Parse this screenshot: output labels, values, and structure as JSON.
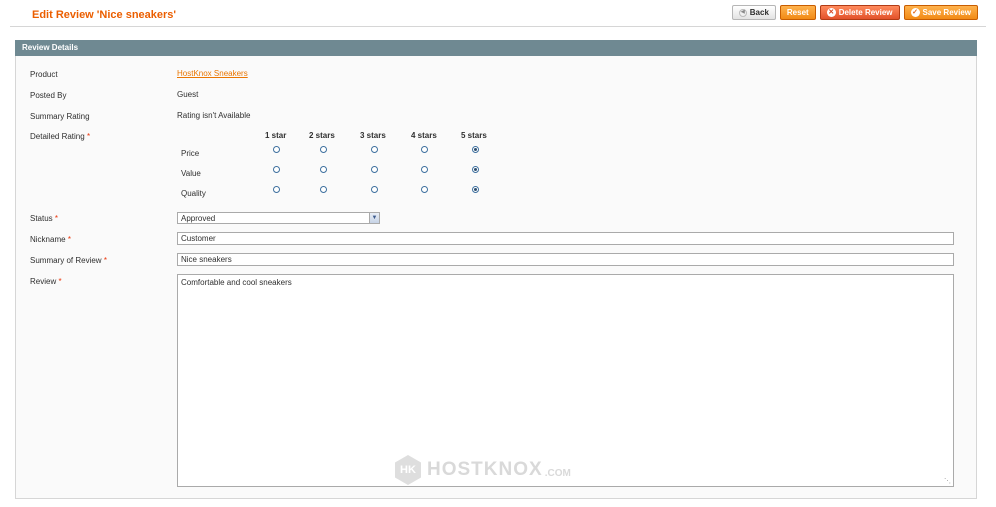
{
  "header": {
    "title": "Edit Review 'Nice sneakers'",
    "buttons": {
      "back": "Back",
      "reset": "Reset",
      "delete": "Delete Review",
      "save": "Save Review"
    }
  },
  "section": {
    "title": "Review Details"
  },
  "fields": {
    "product_label": "Product",
    "product_value": "HostKnox Sneakers",
    "posted_by_label": "Posted By",
    "posted_by_value": "Guest",
    "summary_rating_label": "Summary Rating",
    "summary_rating_value": "Rating isn't Available",
    "detailed_rating_label": "Detailed Rating",
    "required_mark": "*",
    "status_label": "Status",
    "status_value": "Approved",
    "nickname_label": "Nickname",
    "nickname_value": "Customer",
    "summary_label": "Summary of Review",
    "summary_value": "Nice sneakers",
    "review_label": "Review",
    "review_value": "Comfortable and cool sneakers"
  },
  "rating": {
    "columns": [
      "1 star",
      "2 stars",
      "3 stars",
      "4 stars",
      "5 stars"
    ],
    "rows": [
      {
        "label": "Price",
        "selected": 5
      },
      {
        "label": "Value",
        "selected": 5
      },
      {
        "label": "Quality",
        "selected": 5
      }
    ]
  },
  "watermark": {
    "brand": "HOSTKNOX",
    "tld": ".COM"
  },
  "colors": {
    "accent": "#eb5e00",
    "section_header": "#6f8992",
    "required": "#eb340a"
  }
}
